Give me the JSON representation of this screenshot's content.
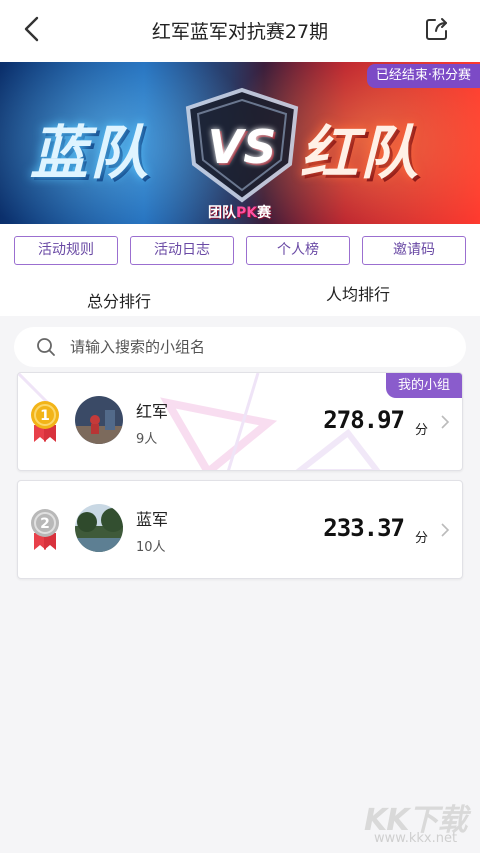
{
  "header": {
    "title": "红军蓝军对抗赛27期",
    "back_icon": "chevron-left-icon",
    "share_icon": "share-icon"
  },
  "banner": {
    "team_left": "蓝队",
    "vs": "VS",
    "team_right": "红队",
    "subtitle_prefix": "团队",
    "subtitle_pk": "PK",
    "subtitle_suffix": "赛",
    "status_tag": "已经结束·积分赛"
  },
  "actions": [
    {
      "label": "活动规则"
    },
    {
      "label": "活动日志"
    },
    {
      "label": "个人榜"
    },
    {
      "label": "邀请码"
    }
  ],
  "tabs": [
    {
      "label": "总分排行"
    },
    {
      "label": "人均排行"
    }
  ],
  "search": {
    "placeholder": "请输入搜索的小组名",
    "value": ""
  },
  "rankings": [
    {
      "rank": "1",
      "name": "红军",
      "members": "9人",
      "score": "278.97",
      "unit": "分",
      "tag": "我的小组",
      "medal_color": "#f2b418"
    },
    {
      "rank": "2",
      "name": "蓝军",
      "members": "10人",
      "score": "233.37",
      "unit": "分",
      "tag": "",
      "medal_color": "#b8b8b8"
    }
  ],
  "watermark": {
    "logo": "KK下载",
    "url": "www.kkx.net"
  },
  "colors": {
    "accent": "#8a5ccc",
    "button_border": "#9b6fd0",
    "gold_medal": "#f2b418",
    "silver_medal": "#b8b8b8",
    "ribbon": "#e8404a"
  }
}
